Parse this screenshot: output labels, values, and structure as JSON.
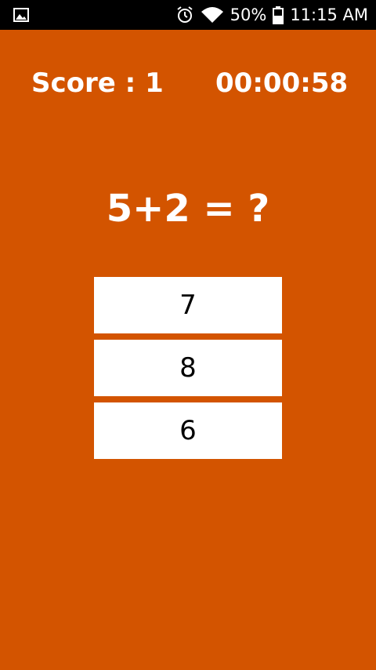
{
  "status_bar": {
    "battery": "50%",
    "time": "11:15 AM",
    "icons": [
      "image-icon",
      "alarm-icon",
      "wifi-icon",
      "battery-icon"
    ]
  },
  "game": {
    "score_label": "Score : 1",
    "timer": "00:00:58",
    "question": "5+2 = ?",
    "answers": [
      "7",
      "8",
      "6"
    ]
  },
  "colors": {
    "background": "#d35400",
    "answer_background": "#ffffff"
  }
}
